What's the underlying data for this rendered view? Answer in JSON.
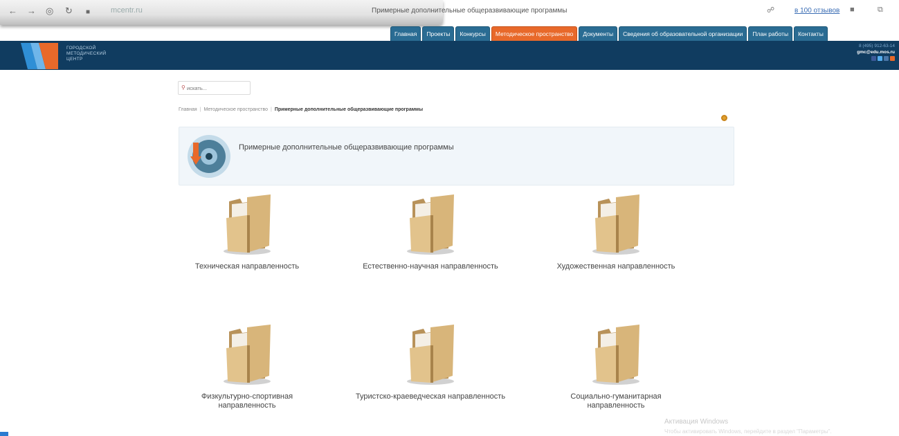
{
  "browser": {
    "url": "mcentr.ru",
    "tab_title": "Примерные дополнительные общеразвивающие программы",
    "time_link": "в 100 отзывов"
  },
  "site": {
    "logo_text": [
      "ГОРОДСКОЙ",
      "МЕТОДИЧЕСКИЙ",
      "ЦЕНТР"
    ],
    "phone": "8 (495) 912-63-14",
    "email": "gmc@edu.mos.ru",
    "colors": {
      "band": "#103c60",
      "menu": "#2a6c93",
      "menu_active": "#e8692a"
    }
  },
  "menu": [
    {
      "label": "Главная",
      "active": false
    },
    {
      "label": "Проекты",
      "active": false
    },
    {
      "label": "Конкурсы",
      "active": false
    },
    {
      "label": "Методическое пространство",
      "active": true
    },
    {
      "label": "Документы",
      "active": false
    },
    {
      "label": "Сведения об образовательной организации",
      "active": false
    },
    {
      "label": "План работы",
      "active": false
    },
    {
      "label": "Контакты",
      "active": false
    }
  ],
  "search": {
    "placeholder": "искать..."
  },
  "breadcrumb": {
    "items": [
      "Главная",
      "Методическое пространство"
    ],
    "current": "Примерные дополнительные общеразвивающие программы"
  },
  "page": {
    "title": "Примерные дополнительные общеразвивающие программы"
  },
  "folders": [
    {
      "label": [
        "Техническая направленность"
      ]
    },
    {
      "label": [
        "Естественно-научная направленность"
      ]
    },
    {
      "label": [
        "Художественная направленность"
      ]
    },
    {
      "label": [
        "Физкультурно-спортивная",
        "направленность"
      ]
    },
    {
      "label": [
        "Туристско-краеведческая направленность"
      ]
    },
    {
      "label": [
        "Социально-гуманитарная",
        "направленность"
      ]
    }
  ],
  "watermark": {
    "title": "Активация Windows",
    "subtitle": "Чтобы активировать Windows, перейдите в раздел \"Параметры\"."
  }
}
